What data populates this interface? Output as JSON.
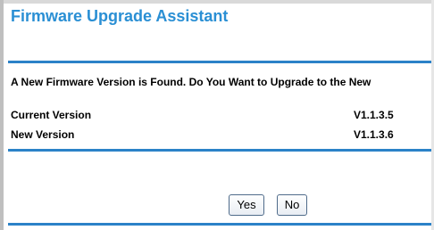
{
  "page": {
    "title": "Firmware Upgrade Assistant",
    "prompt": "A New Firmware Version is Found. Do You Want to Upgrade to the New"
  },
  "versions": {
    "current": {
      "label": "Current Version",
      "value": "V1.1.3.5"
    },
    "new": {
      "label": "New Version",
      "value": "V1.1.3.6"
    }
  },
  "buttons": {
    "yes": "Yes",
    "no": "No"
  },
  "colors": {
    "title": "#2a8fd4",
    "rule": "#2b82c8"
  }
}
